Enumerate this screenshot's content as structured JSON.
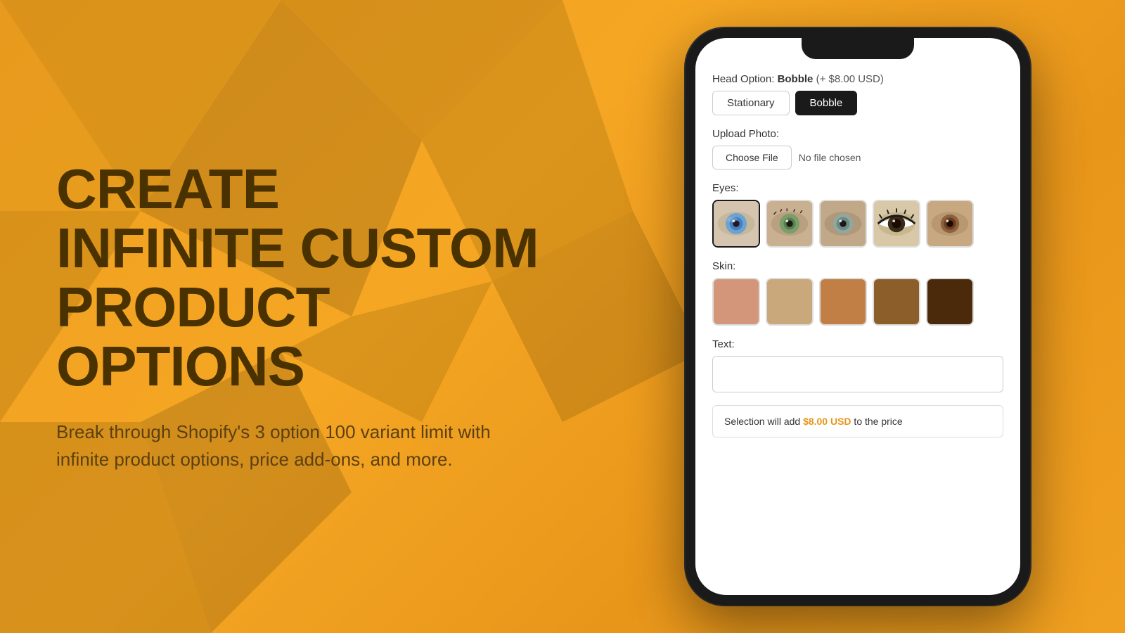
{
  "background": {
    "color": "#F5A623"
  },
  "left": {
    "headline_line1": "CREATE",
    "headline_line2": "INFINITE CUSTOM",
    "headline_line3": "PRODUCT OPTIONS",
    "subtext": "Break through Shopify's 3 option 100 variant limit with infinite product options, price add-ons, and more."
  },
  "phone": {
    "head_option": {
      "label": "Head Option:",
      "selected_value": "Bobble",
      "price_addon": "(+ $8.00 USD)",
      "buttons": [
        "Stationary",
        "Bobble"
      ],
      "active_button": "Bobble"
    },
    "upload": {
      "label": "Upload Photo:",
      "button_label": "Choose File",
      "no_file_text": "No file chosen"
    },
    "eyes": {
      "label": "Eyes:",
      "swatches": [
        {
          "id": "eye1",
          "color_hint": "#4A90D9",
          "selected": true
        },
        {
          "id": "eye2",
          "color_hint": "#6B8E6B",
          "selected": false
        },
        {
          "id": "eye3",
          "color_hint": "#8FA8A8",
          "selected": false
        },
        {
          "id": "eye4",
          "color_hint": "#2a2a2a",
          "selected": false
        },
        {
          "id": "eye5",
          "color_hint": "#8B5E3C",
          "selected": false
        }
      ]
    },
    "skin": {
      "label": "Skin:",
      "swatches": [
        {
          "id": "skin1",
          "color": "#D4967A",
          "selected": false
        },
        {
          "id": "skin2",
          "color": "#C9A87C",
          "selected": false
        },
        {
          "id": "skin3",
          "color": "#C17F45",
          "selected": false
        },
        {
          "id": "skin4",
          "color": "#8B5E2A",
          "selected": false
        },
        {
          "id": "skin5",
          "color": "#4A2A0A",
          "selected": false
        }
      ]
    },
    "text_field": {
      "label": "Text:",
      "placeholder": ""
    },
    "price_banner": {
      "prefix": "Selection will add ",
      "price": "$8.00 USD",
      "suffix": " to the price"
    }
  }
}
